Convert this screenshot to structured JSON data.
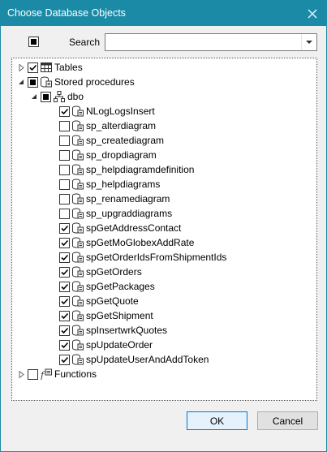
{
  "window": {
    "title": "Choose Database Objects"
  },
  "toolbar": {
    "search_label": "Search",
    "search_value": ""
  },
  "tree": {
    "tables": {
      "label": "Tables",
      "state": "checked",
      "expanded": false
    },
    "stored_procedures": {
      "label": "Stored procedures",
      "state": "partial",
      "expanded": true
    },
    "dbo": {
      "label": "dbo",
      "state": "partial",
      "expanded": true
    },
    "procedures": [
      {
        "label": "NLogLogsInsert",
        "checked": true
      },
      {
        "label": "sp_alterdiagram",
        "checked": false
      },
      {
        "label": "sp_creatediagram",
        "checked": false
      },
      {
        "label": "sp_dropdiagram",
        "checked": false
      },
      {
        "label": "sp_helpdiagramdefinition",
        "checked": false
      },
      {
        "label": "sp_helpdiagrams",
        "checked": false
      },
      {
        "label": "sp_renamediagram",
        "checked": false
      },
      {
        "label": "sp_upgraddiagrams",
        "checked": false
      },
      {
        "label": "spGetAddressContact",
        "checked": true
      },
      {
        "label": "spGetMoGlobexAddRate",
        "checked": true
      },
      {
        "label": "spGetOrderIdsFromShipmentIds",
        "checked": true
      },
      {
        "label": "spGetOrders",
        "checked": true
      },
      {
        "label": "spGetPackages",
        "checked": true
      },
      {
        "label": "spGetQuote",
        "checked": true
      },
      {
        "label": "spGetShipment",
        "checked": true
      },
      {
        "label": "spInsertwrkQuotes",
        "checked": true
      },
      {
        "label": "spUpdateOrder",
        "checked": true
      },
      {
        "label": "spUpdateUserAndAddToken",
        "checked": true
      }
    ],
    "functions": {
      "label": "Functions",
      "state": "unchecked",
      "expanded": false
    }
  },
  "buttons": {
    "ok_label": "OK",
    "cancel_label": "Cancel"
  },
  "colors": {
    "titlebar": "#1b8aa6",
    "dialog_bg": "#f0f0f0",
    "ok_border": "#0078d7"
  }
}
